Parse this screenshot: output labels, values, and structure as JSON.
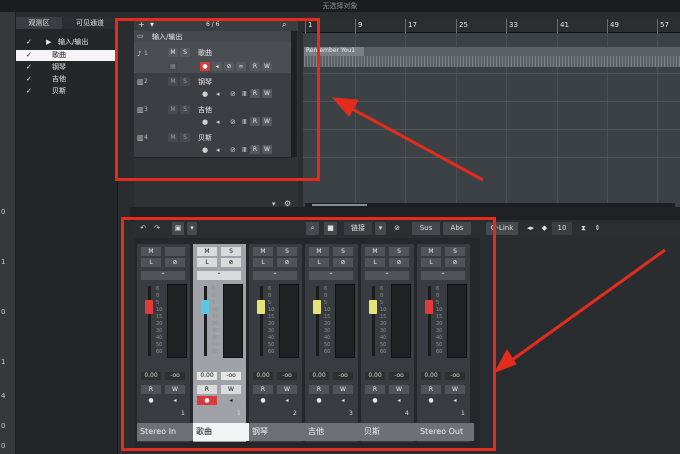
{
  "window": {
    "title": "无选择对象"
  },
  "left_rail": {
    "numbers": [
      "0",
      "1",
      "0",
      "1",
      "4",
      "0",
      "0"
    ]
  },
  "visibility": {
    "tabs": [
      "观测区",
      "可见通道"
    ],
    "items": [
      {
        "label": "输入/输出",
        "checked": true,
        "selected": false
      },
      {
        "label": "歌曲",
        "checked": true,
        "selected": true
      },
      {
        "label": "钢琴",
        "checked": true,
        "selected": false
      },
      {
        "label": "吉他",
        "checked": true,
        "selected": false
      },
      {
        "label": "贝斯",
        "checked": true,
        "selected": false
      }
    ]
  },
  "track_header": {
    "folder": "输入/输出",
    "count": "6 / 6"
  },
  "tracks": [
    {
      "num": "1",
      "name": "歌曲",
      "mute": "M",
      "solo": "S",
      "read": "R",
      "write": "W",
      "record_armed": true
    },
    {
      "num": "2",
      "name": "钢琴",
      "mute": "M",
      "solo": "S",
      "read": "R",
      "write": "W",
      "record_armed": false
    },
    {
      "num": "3",
      "name": "吉他",
      "mute": "M",
      "solo": "S",
      "read": "R",
      "write": "W",
      "record_armed": false
    },
    {
      "num": "4",
      "name": "贝斯",
      "mute": "M",
      "solo": "S",
      "read": "R",
      "write": "W",
      "record_armed": false
    }
  ],
  "ruler": [
    "1",
    "9",
    "17",
    "25",
    "33",
    "41",
    "49",
    "57"
  ],
  "clip": {
    "name": "Remember You1"
  },
  "mixer_toolbar": {
    "link_label": "链接",
    "sus_label": "Sus",
    "abs_label": "Abs",
    "qlink_label": "Q-Link",
    "count": "10"
  },
  "channels": [
    {
      "name": "Stereo In",
      "num": "1",
      "mute": "M",
      "solo": "",
      "read": "R",
      "write": "W",
      "val1": "0.00",
      "val2": "-oo",
      "fader_color": "#e23b3b",
      "selected": false
    },
    {
      "name": "歌曲",
      "num": "1",
      "mute": "M",
      "solo": "S",
      "read": "R",
      "write": "W",
      "val1": "0.00",
      "val2": "-oo",
      "fader_color": "#59c6e6",
      "selected": true
    },
    {
      "name": "钢琴",
      "num": "2",
      "mute": "M",
      "solo": "S",
      "read": "R",
      "write": "W",
      "val1": "0.00",
      "val2": "-oo",
      "fader_color": "#e8e27a",
      "selected": false
    },
    {
      "name": "吉他",
      "num": "3",
      "mute": "M",
      "solo": "S",
      "read": "R",
      "write": "W",
      "val1": "0.00",
      "val2": "-oo",
      "fader_color": "#e8e27a",
      "selected": false
    },
    {
      "name": "贝斯",
      "num": "4",
      "mute": "M",
      "solo": "S",
      "read": "R",
      "write": "W",
      "val1": "0.00",
      "val2": "-oo",
      "fader_color": "#e8e27a",
      "selected": false
    },
    {
      "name": "Stereo Out",
      "num": "1",
      "mute": "M",
      "solo": "S",
      "read": "R",
      "write": "W",
      "val1": "0.00",
      "val2": "-oo",
      "fader_color": "#e23b3b",
      "selected": false
    }
  ],
  "meter_scale": [
    "6",
    "0",
    "5",
    "10",
    "15",
    "20",
    "30",
    "40",
    "50",
    "60"
  ],
  "colors": {
    "annotation": "#e52b1b",
    "accent": "#59c6e6"
  }
}
